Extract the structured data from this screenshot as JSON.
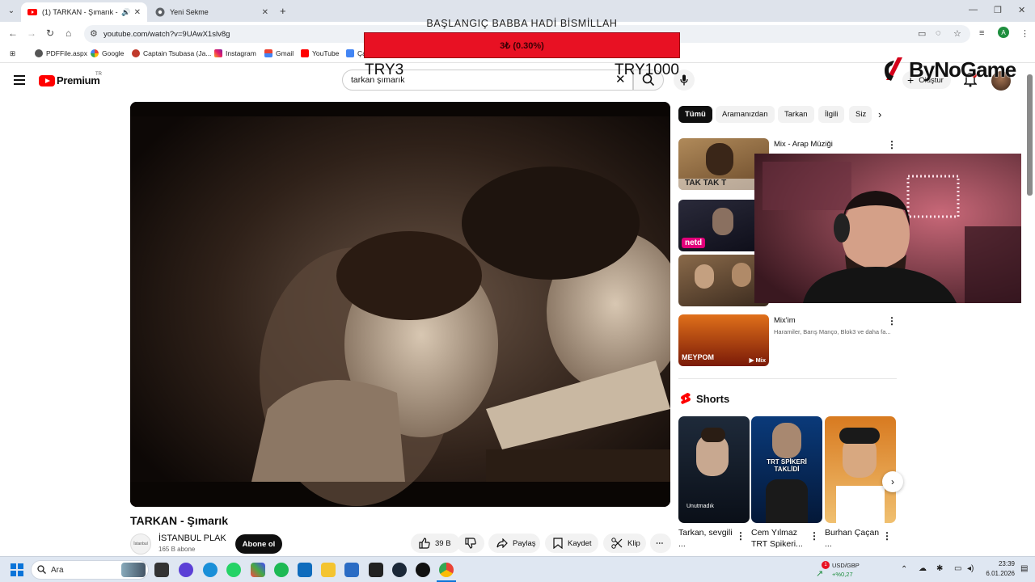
{
  "browser": {
    "tabs": [
      {
        "title": "(1) TARKAN - Şımarık - YouTube",
        "active": true
      },
      {
        "title": "Yeni Sekme",
        "active": false
      }
    ],
    "url": "youtube.com/watch?v=9UAwX1slv8g",
    "bookmarks": [
      "PDFFile.aspx",
      "Google",
      "Captain Tsubasa (Ja...",
      "Instagram",
      "Gmail",
      "YouTube",
      "Ça"
    ]
  },
  "overlay": {
    "title": "BAŞLANGIÇ BABBA HADİ BİSMİLLAH",
    "progress_label": "3₺ (0.30%)",
    "progress_fraction": 0.003,
    "min_label": "TRY3",
    "max_label": "TRY1000",
    "sponsor": "ByNoGame"
  },
  "youtube": {
    "logo_text": "Premium",
    "region": "TR",
    "search_value": "tarkan şımarık",
    "create_label": "Oluştur",
    "video": {
      "title": "TARKAN - Şımarık",
      "channel": "İSTANBUL PLAK",
      "channel_logo_text": "İstanbul",
      "subscribers": "165 B abone",
      "subscribe_label": "Abone ol",
      "likes": "39 B",
      "share_label": "Paylaş",
      "save_label": "Kaydet",
      "clip_label": "Klip"
    },
    "chips": [
      "Tümü",
      "Aramanızdan",
      "Tarkan",
      "İlgili",
      "Siz"
    ],
    "recommendations": [
      {
        "title": "Mix - Arap Müziği",
        "sub": "",
        "badge": "",
        "thumb_text": "TAK TAK T"
      },
      {
        "title": "",
        "sub": "",
        "badge": "",
        "thumb_text": "netd"
      },
      {
        "title": "",
        "sub": "",
        "badge": "",
        "thumb_text": ""
      },
      {
        "title": "Mix'im",
        "sub": "Haramiler, Barış Manço, Blok3 ve daha fa...",
        "badge": "Mix",
        "thumb_text": "MEYPOM"
      }
    ],
    "shorts_heading": "Shorts",
    "shorts": [
      {
        "title": "Tarkan, sevgili ...",
        "overlay": "Unutmadık"
      },
      {
        "title": "Cem Yılmaz TRT Spikeri...",
        "overlay": "TRT SPİKERİ TAKLİDİ"
      },
      {
        "title": "Burhan Çaçan ...",
        "overlay": ""
      }
    ]
  },
  "taskbar": {
    "search_placeholder": "Ara",
    "stock_name": "USD/GBP",
    "stock_change": "+%0,27",
    "stock_badge": "1",
    "time": "23:39",
    "date": "6.01.2026"
  },
  "colors": {
    "youtube_red": "#ff0000",
    "overlay_bar": "#e81123",
    "dark": "#0f0f0f"
  }
}
